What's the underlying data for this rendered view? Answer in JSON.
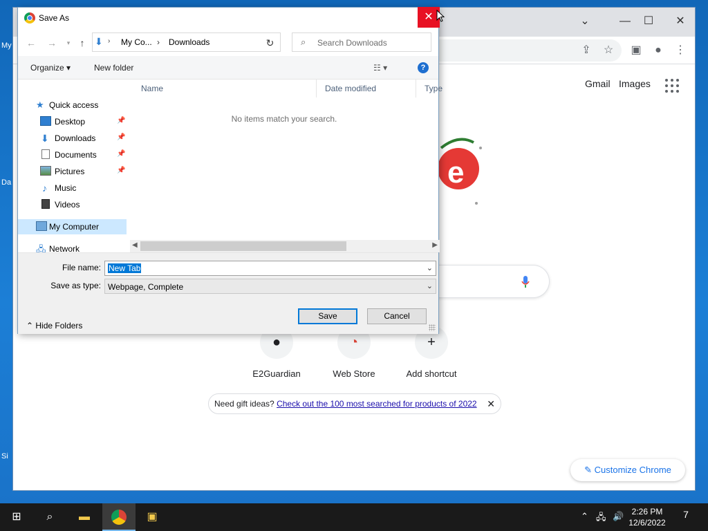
{
  "desktop": {
    "fragments": [
      "My",
      "Da",
      "Si"
    ]
  },
  "chrome": {
    "links": {
      "gmail": "Gmail",
      "images": "Images"
    },
    "shortcuts": [
      {
        "label": "E2Guardian",
        "icon": "github-icon"
      },
      {
        "label": "Web Store",
        "icon": "chrome-webstore-icon"
      },
      {
        "label": "Add shortcut",
        "icon": "plus-icon"
      }
    ],
    "promo": {
      "prefix": "Need gift ideas?",
      "link": "Check out the 100 most searched for products of 2022"
    },
    "customize": "Customize Chrome"
  },
  "dialog": {
    "title": "Save As",
    "breadcrumb": [
      "My Co...",
      "Downloads"
    ],
    "search_placeholder": "Search Downloads",
    "toolbar": {
      "organize": "Organize ▾",
      "new_folder": "New folder"
    },
    "nav": [
      {
        "label": "Quick access",
        "icon": "star-icon"
      },
      {
        "label": "Desktop",
        "icon": "desktop-icon",
        "pinned": true
      },
      {
        "label": "Downloads",
        "icon": "download-icon",
        "pinned": true
      },
      {
        "label": "Documents",
        "icon": "documents-icon",
        "pinned": true
      },
      {
        "label": "Pictures",
        "icon": "pictures-icon",
        "pinned": true
      },
      {
        "label": "Music",
        "icon": "music-icon"
      },
      {
        "label": "Videos",
        "icon": "videos-icon"
      },
      {
        "label": "My Computer",
        "icon": "computer-icon",
        "selected": true
      },
      {
        "label": "Network",
        "icon": "network-icon"
      }
    ],
    "columns": [
      "Name",
      "Date modified",
      "Type"
    ],
    "empty_message": "No items match your search.",
    "file_name_label": "File name:",
    "file_name_value": "New Tab",
    "save_type_label": "Save as type:",
    "save_type_value": "Webpage, Complete",
    "save_button": "Save",
    "cancel_button": "Cancel",
    "hide_folders": "Hide Folders"
  },
  "taskbar": {
    "time": "2:26 PM",
    "date": "12/6/2022",
    "notification_count": "7"
  }
}
